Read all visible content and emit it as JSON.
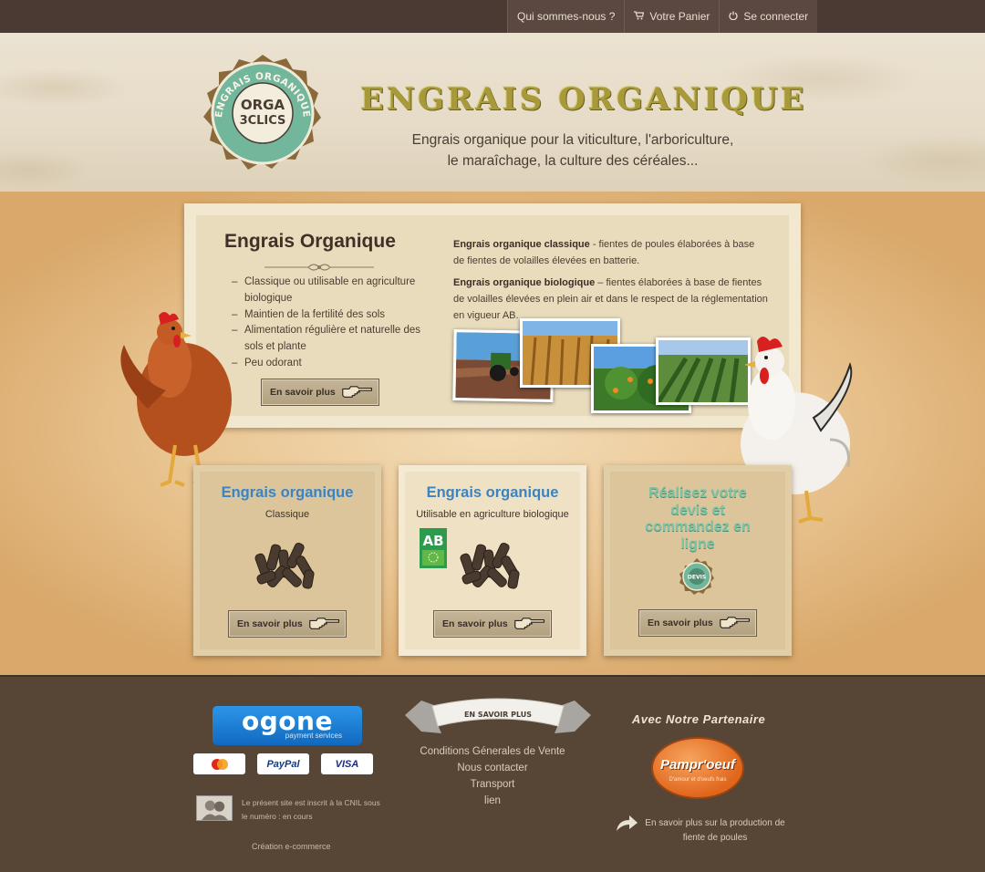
{
  "nav": {
    "items": [
      {
        "label": "Qui sommes-nous ?",
        "icon": ""
      },
      {
        "label": "Votre Panier",
        "icon": "cart-icon"
      },
      {
        "label": "Se connecter",
        "icon": "power-icon"
      }
    ]
  },
  "header": {
    "logo": {
      "ring_text": "ENGRAIS ORGANIQUE",
      "name_line1": "ORGA",
      "name_line2": "3CLICS"
    },
    "title": "ENGRAIS ORGANIQUE",
    "tagline_line1": "Engrais organique pour la viticulture, l'arboriculture,",
    "tagline_line2": "le maraîchage, la culture des céréales..."
  },
  "feature": {
    "title": "Engrais Organique",
    "bullets": [
      "Classique ou utilisable en agriculture biologique",
      "Maintien de la fertilité des sols",
      "Alimentation régulière et naturelle des sols et plante",
      "Peu odorant"
    ],
    "button_label": "En savoir plus",
    "para1_bold": "Engrais organique classique",
    "para1_text": " - fientes de poules élaborées à base de fientes de volailles élevées en batterie.",
    "para2_bold": "Engrais organique biologique",
    "para2_text": " – fientes élaborées à base de fientes de volailles élevées en plein air et dans le respect de la réglementation en vigueur AB."
  },
  "cards": [
    {
      "title": "Engrais organique",
      "subtitle": "Classique",
      "button_label": "En savoir plus"
    },
    {
      "title": "Engrais organique",
      "subtitle": "Utilisable en agriculture biologique",
      "badge_text": "AB",
      "button_label": "En savoir plus"
    },
    {
      "title": "Réalisez votre devis et commandez en ligne",
      "badge_text": "DEVIS",
      "button_label": "En savoir plus"
    }
  ],
  "footer": {
    "ogone_title": "ogone",
    "ogone_sub": "payment services",
    "payments": [
      "",
      "PayPal",
      "VISA"
    ],
    "cnil_text": "Le présent site est inscrit à la CNIL sous le numéro : en cours",
    "creation": "Création e-commerce",
    "ribbon_label": "EN SAVOIR PLUS",
    "links": [
      "Conditions Génerales de Vente",
      "Nous contacter",
      "Transport",
      "lien"
    ],
    "partner_title": "Avec Notre Partenaire",
    "partner_logo": "Pampr'oeuf",
    "partner_tagline": "D'amour et d'oeufs frais",
    "partner_link": "En savoir plus sur la production de fiente de poules"
  },
  "colors": {
    "nav_bg": "#4a3a33",
    "title_olive": "#a89a3a",
    "card_title_blue": "#3a83c4",
    "devis_green": "#7fc3a7",
    "footer_bg": "#574636"
  }
}
